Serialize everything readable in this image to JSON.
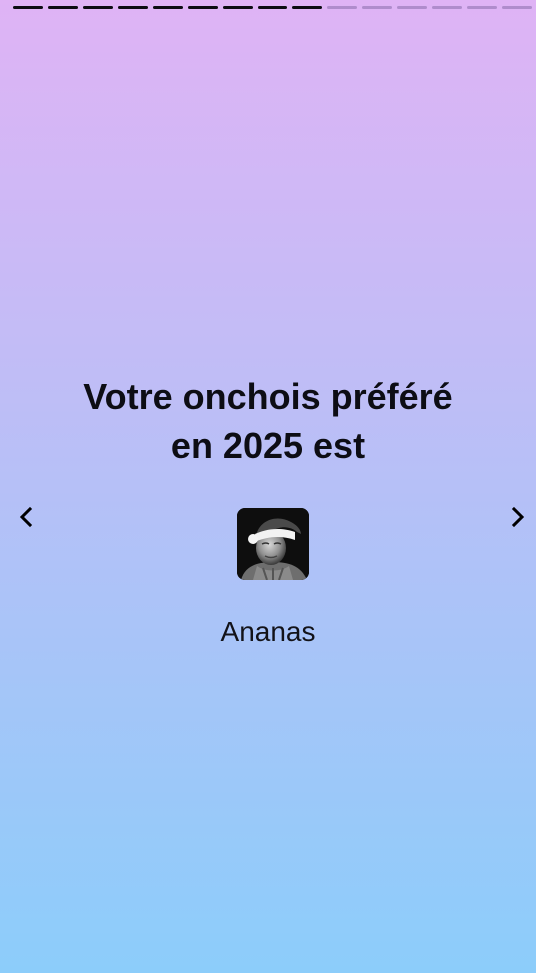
{
  "story": {
    "total_segments": 15,
    "completed_segments": 9,
    "title_line1": "Votre onchois préféré",
    "title_line2": "en 2025 est",
    "winner_name": "Ananas"
  },
  "nav": {
    "prev_icon": "chevron-left-icon",
    "next_icon": "chevron-right-icon"
  },
  "colors": {
    "segment_done": "#0b0b12",
    "segment_pending": "#9a86b0",
    "text": "#0d0d14"
  }
}
